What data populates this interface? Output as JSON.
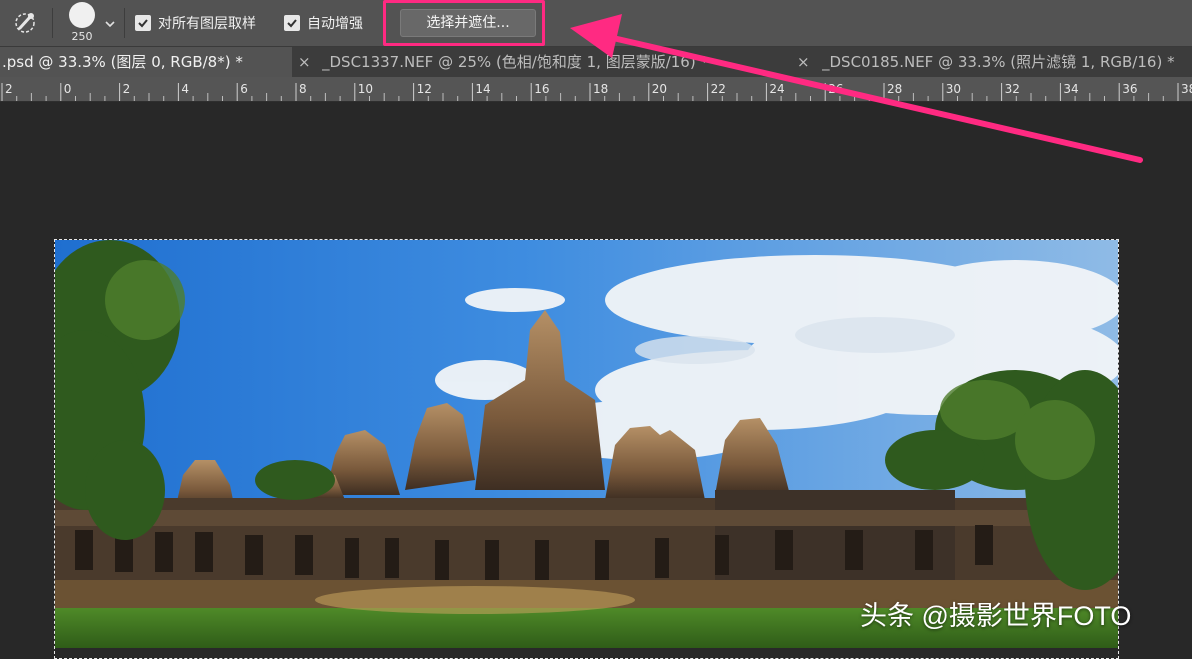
{
  "options_bar": {
    "brush_size": "250",
    "sample_all_layers_label": "对所有图层取样",
    "auto_enhance_label": "自动增强",
    "select_and_mask_label": "选择并遮住..."
  },
  "tabs": [
    {
      "label": ".psd @ 33.3% (图层 0, RGB/8*) *",
      "active": true
    },
    {
      "label": "_DSC1337.NEF @ 25% (色相/饱和度 1, 图层蒙版/16) *",
      "active": false
    },
    {
      "label": "_DSC0185.NEF @ 33.3% (照片滤镜 1, RGB/16) *",
      "active": false
    }
  ],
  "tab_close_glyph": "×",
  "ruler_labels": [
    "2",
    "0",
    "2",
    "4",
    "6",
    "8",
    "10",
    "12",
    "14",
    "16",
    "18",
    "20",
    "22",
    "24",
    "26",
    "28",
    "30",
    "32",
    "34",
    "36",
    "38"
  ],
  "watermark": "头条 @摄影世界FOTO",
  "colors": {
    "highlight": "#ff2a82",
    "options_bar_bg": "#535353",
    "workspace_bg": "#282828"
  },
  "icons": {
    "tool": "quick-selection-icon",
    "check": "checkmark-icon",
    "dropdown": "chevron-down-icon"
  }
}
